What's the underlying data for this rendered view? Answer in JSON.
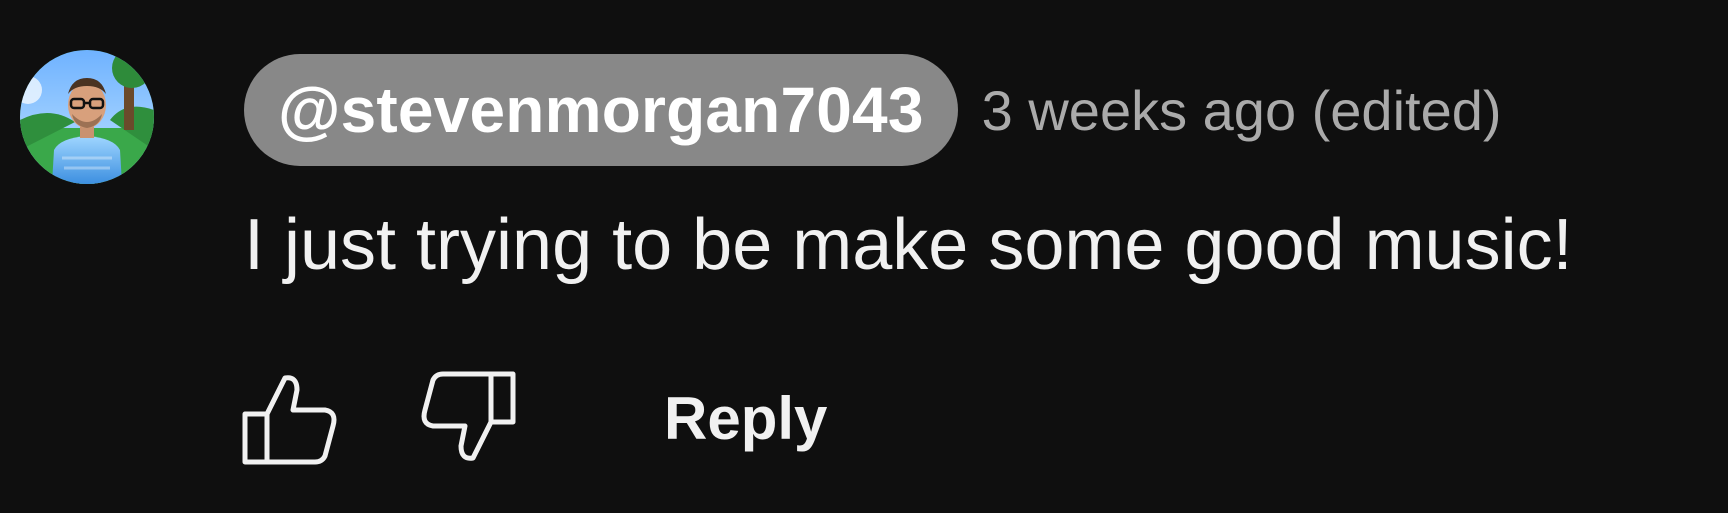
{
  "comment": {
    "author": "@stevenmorgan7043",
    "timestamp": "3 weeks ago (edited)",
    "text": "I just trying to be make some good music!",
    "avatar_icon": "avatar-icon"
  },
  "actions": {
    "like_icon": "thumbs-up-icon",
    "dislike_icon": "thumbs-down-icon",
    "reply_label": "Reply"
  },
  "colors": {
    "background": "#0f0f0f",
    "author_chip_bg": "#888888",
    "timestamp": "#aaaaaa",
    "text": "#f1f1f1"
  }
}
